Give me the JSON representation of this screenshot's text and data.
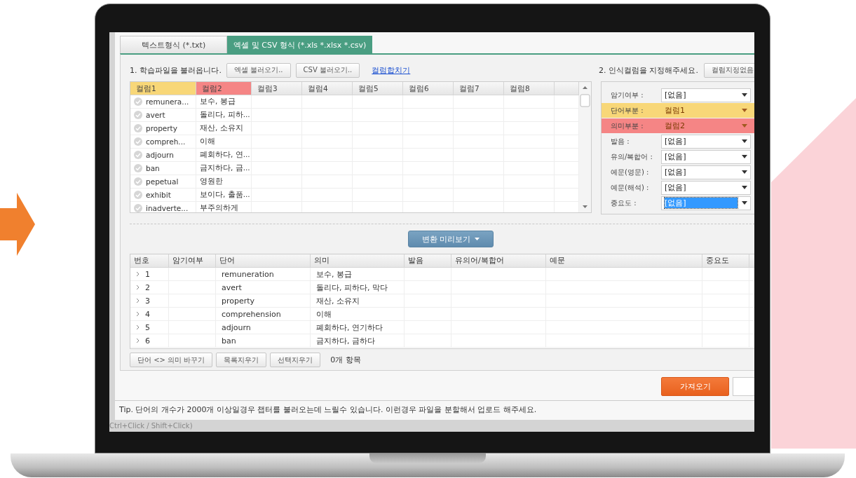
{
  "tabs": [
    {
      "label": "텍스트형식 (*.txt)",
      "selected": false
    },
    {
      "label": "엑셀 및 CSV 형식 (*.xls *.xlsx *.csv)",
      "selected": true
    }
  ],
  "load": {
    "label": "1. 학습파일을 불러옵니다.",
    "buttons": [
      "엑셀 불러오기..",
      "CSV 불러오기.."
    ],
    "link": "컬럼합치기"
  },
  "source_grid": {
    "columns": [
      {
        "label": "컬럼1",
        "color": "#f8d778"
      },
      {
        "label": "컬럼2",
        "color": "#f58585"
      },
      {
        "label": "컬럼3"
      },
      {
        "label": "컬럼4"
      },
      {
        "label": "컬럼5"
      },
      {
        "label": "컬럼6"
      },
      {
        "label": "컬럼7"
      },
      {
        "label": "컬럼8"
      }
    ],
    "rows": [
      [
        "remunera...",
        "보수, 봉급"
      ],
      [
        "avert",
        "돌리다, 피하..."
      ],
      [
        "property",
        "재산, 소유지"
      ],
      [
        "compreh...",
        "이해"
      ],
      [
        "adjourn",
        "폐회하다, 연..."
      ],
      [
        "ban",
        "금지하다, 금..."
      ],
      [
        "pepetual",
        "영원한"
      ],
      [
        "exhibit",
        "보이다, 출품..."
      ],
      [
        "inadverte...",
        "부주의하게"
      ]
    ]
  },
  "mapping": {
    "label": "2. 인식컬럼을 지정해주세요.",
    "button": "컬럼지정없음",
    "fields": [
      {
        "label": "암기여부 :",
        "value": "[없음]",
        "focused": false
      },
      {
        "label": "단어부분 :",
        "value": "컬럼1",
        "focused": false,
        "color": "#f8d778"
      },
      {
        "label": "의미부분 :",
        "value": "컬럼2",
        "focused": false,
        "color": "#f58585"
      },
      {
        "label": "발음 :",
        "value": "[없음]",
        "focused": false
      },
      {
        "label": "유의/복합어 :",
        "value": "[없음]",
        "focused": false
      },
      {
        "label": "예문(영문) :",
        "value": "[없음]",
        "focused": false
      },
      {
        "label": "예문(해석) :",
        "value": "[없음]",
        "focused": false
      },
      {
        "label": "중요도 :",
        "value": "[없음]",
        "focused": true
      }
    ]
  },
  "preview_button": "변환 미리보기",
  "result_table": {
    "columns": [
      "번호",
      "암기여부",
      "단어",
      "의미",
      "발음",
      "유의어/복합어",
      "예문",
      "중요도"
    ],
    "rows": [
      {
        "number": "1",
        "word": "remuneration",
        "meaning": "보수, 봉급"
      },
      {
        "number": "2",
        "word": "avert",
        "meaning": "돌리다, 피하다, 막다"
      },
      {
        "number": "3",
        "word": "property",
        "meaning": "재산, 소유지"
      },
      {
        "number": "4",
        "word": "comprehension",
        "meaning": "이해"
      },
      {
        "number": "5",
        "word": "adjourn",
        "meaning": "폐회하다, 연기하다"
      },
      {
        "number": "6",
        "word": "ban",
        "meaning": "금지하다, 금하다"
      }
    ]
  },
  "actions": [
    "단어 <> 의미 바꾸기",
    "목록지우기",
    "선택지우기"
  ],
  "item_count": "0개 항목",
  "import_button": "가져오기",
  "tip": "Tip. 단어의 개수가 2000개 이상일경우 챕터를 불러오는데 느릴수 있습니다. 이런경우 파일을 분할해서 업로드 해주세요.",
  "background_hint": "Ctrl+Click / Shift+Click)"
}
